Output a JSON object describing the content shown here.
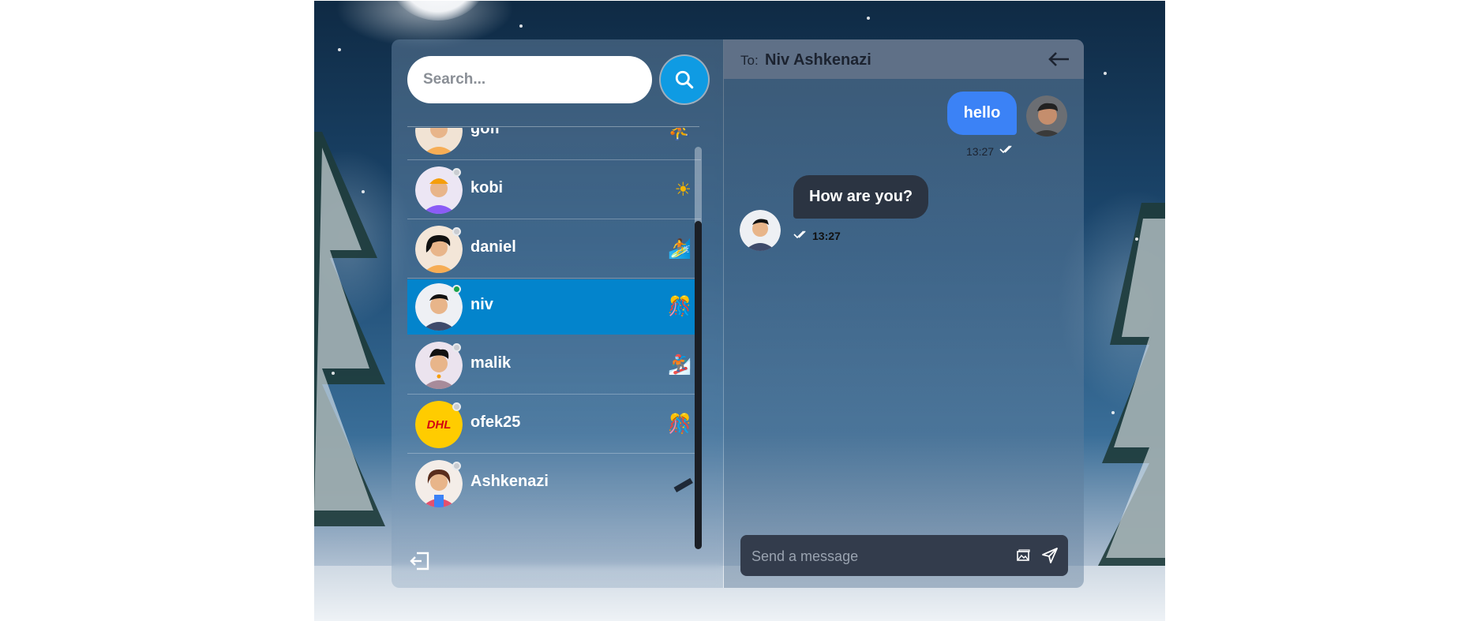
{
  "search": {
    "placeholder": "Search..."
  },
  "users": [
    {
      "name": "gofi",
      "online": false,
      "status_icon": "running-person"
    },
    {
      "name": "kobi",
      "online": false,
      "status_icon": "sun"
    },
    {
      "name": "daniel",
      "online": false,
      "status_icon": "surfing"
    },
    {
      "name": "niv",
      "online": true,
      "status_icon": "party",
      "active": true
    },
    {
      "name": "malik",
      "online": false,
      "status_icon": "snowboarding"
    },
    {
      "name": "ofek25",
      "online": false,
      "status_icon": "party"
    },
    {
      "name": "Ashkenazi",
      "online": false,
      "status_icon": "pencil"
    }
  ],
  "avatar_logo_text": "DHL",
  "chat": {
    "to_label": "To:",
    "to_name": "Niv Ashkenazi",
    "messages": [
      {
        "direction": "outgoing",
        "text": "hello",
        "time": "13:27"
      },
      {
        "direction": "incoming",
        "text": "How are you?",
        "time": "13:27"
      }
    ]
  },
  "composer": {
    "placeholder": "Send a message"
  },
  "colors": {
    "accent": "#0f9be3",
    "active_row": "#0384cc",
    "outgoing_bubble": "#3b82f6",
    "incoming_bubble": "#2b3442",
    "header": "#5f7087",
    "online": "#1aa34a"
  }
}
